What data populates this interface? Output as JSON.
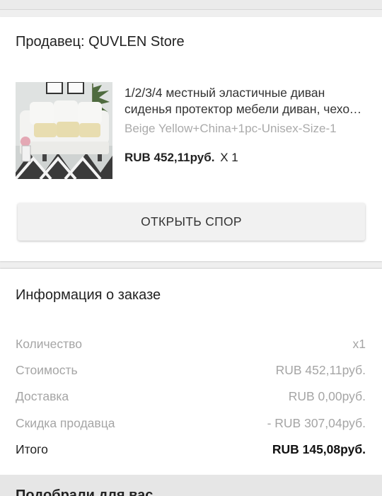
{
  "seller": {
    "label": "Продавец: QUVLEN Store"
  },
  "product": {
    "image": "product-thumbnail",
    "title": "1/2/3/4 местный эластичные диван сиденья протектор мебели диван, чехол для дивана",
    "variant": "Beige Yellow+China+1pc-Unisex-Size-1",
    "price": "RUB 452,11руб.",
    "quantity": "X 1"
  },
  "actions": {
    "open_dispute": "ОТКРЫТЬ СПОР"
  },
  "order_info": {
    "title": "Информация о заказе",
    "rows": [
      {
        "label": "Количество",
        "value": "x1"
      },
      {
        "label": "Стоимость",
        "value": "RUB 452,11руб."
      },
      {
        "label": "Доставка",
        "value": "RUB 0,00руб."
      },
      {
        "label": "Скидка продавца",
        "value": "- RUB 307,04руб."
      }
    ],
    "total": {
      "label": "Итого",
      "value": "RUB 145,08руб."
    }
  },
  "recommendations": {
    "title": "Подобрали для вас"
  }
}
